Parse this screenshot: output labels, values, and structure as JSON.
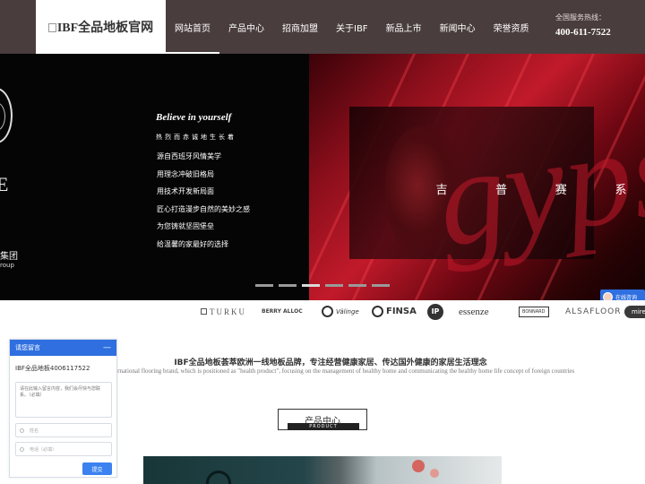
{
  "header": {
    "logo_alt": "IBF全品地板官网",
    "nav": [
      {
        "label": "网站首页",
        "active": true
      },
      {
        "label": "产品中心"
      },
      {
        "label": "招商加盟"
      },
      {
        "label": "关于IBF"
      },
      {
        "label": "新品上市"
      },
      {
        "label": "新闻中心"
      },
      {
        "label": "荣誉资质"
      }
    ],
    "hotline_label": "全国服务热线：",
    "hotline_number": "400-611-7522"
  },
  "banner": {
    "left_letter": "E",
    "group_cn": "集团",
    "group_en": "roup",
    "script_title": "Believe in yourself",
    "subtitle": "热烈而赤诚地生长着",
    "slogans": [
      "源自西班牙风情美学",
      "用理念冲破旧格局",
      "用技术开发新局面",
      "匠心打造漫步自然的美妙之感",
      "为您铸就坚固堡垒",
      "给温馨的家最好的选择"
    ],
    "background_word": "gypsy",
    "series_title": [
      "吉",
      "普",
      "赛",
      "系"
    ],
    "slide_count": 6,
    "active_slide": 3,
    "chat_button": "在线咨询"
  },
  "brands": [
    "TURKU",
    "BERRY ALLOC",
    "Välinge",
    "FINSA",
    "IP",
    "essenze",
    "BONNARD",
    "ALSAFLOOR",
    "mire"
  ],
  "intro": {
    "cn": "IBF全品地板荟萃欧洲一线地板品牌，专注经营健康家居、传达国外健康的家居生活理念",
    "en": "ernational flooring brand, which is positioned as \"health product\", focusing on the management of healthy home and communicating the healthy home life concept of foreign countries"
  },
  "product_section": {
    "title": "产品中心",
    "subtitle": "PRODUCT"
  },
  "chat_widget": {
    "title": "请您留言",
    "minimize": "—",
    "company": "IBF全品地板4006117522",
    "message_placeholder": "请在此输入留言内容，我们会尽快与您联系。（必填）",
    "name_placeholder": "姓名",
    "phone_placeholder": "电话（必填）",
    "submit": "提交"
  },
  "colors": {
    "header_bg": "#4a3d3d",
    "banner_red": "#c11a2a",
    "chat_blue": "#2f6fe0"
  }
}
